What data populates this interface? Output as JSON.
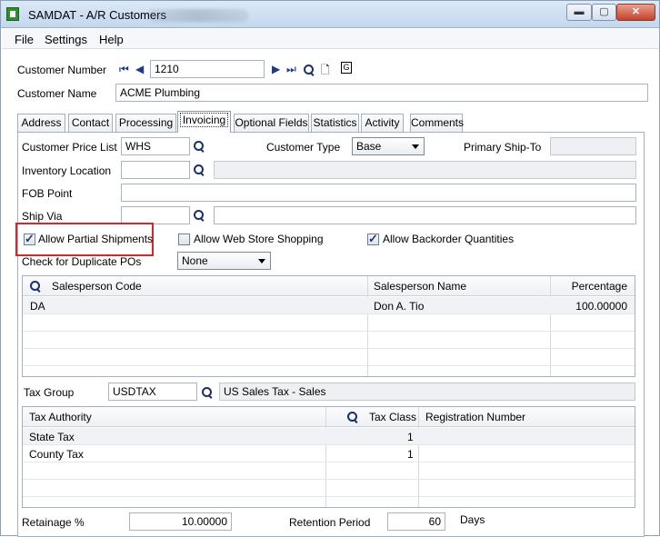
{
  "window": {
    "title": "SAMDAT - A/R Customers",
    "min_glyph": "▬",
    "max_glyph": "▢",
    "close_glyph": "✕"
  },
  "menu": {
    "items": [
      "File",
      "Settings",
      "Help"
    ]
  },
  "header": {
    "customer_number_label": "Customer Number",
    "customer_number_value": "1210",
    "customer_name_label": "Customer Name",
    "customer_name_value": "ACME Plumbing",
    "nav_icons": [
      "first-record-icon",
      "previous-record-icon",
      "next-record-icon",
      "last-record-icon",
      "lookup-icon",
      "new-document-icon",
      "copy-icon"
    ]
  },
  "tabs": [
    {
      "label": "Address"
    },
    {
      "label": "Contact"
    },
    {
      "label": "Processing"
    },
    {
      "label": "Invoicing"
    },
    {
      "label": "Optional Fields"
    },
    {
      "label": "Statistics"
    },
    {
      "label": "Activity"
    },
    {
      "label": "Comments"
    }
  ],
  "invoicing": {
    "price_list_label": "Customer Price List",
    "price_list_value": "WHS",
    "customer_type_label": "Customer Type",
    "customer_type_value": "Base",
    "primary_ship_to_label": "Primary Ship-To",
    "primary_ship_to_value": "",
    "inventory_location_label": "Inventory Location",
    "inventory_location_value": "",
    "fob_point_label": "FOB Point",
    "fob_point_value": "",
    "ship_via_label": "Ship Via",
    "ship_via_value": "",
    "allow_partial_label": "Allow Partial Shipments",
    "allow_web_label": "Allow Web Store Shopping",
    "allow_backorder_label": "Allow Backorder Quantities",
    "duplicate_po_label": "Check for Duplicate POs",
    "duplicate_po_value": "None",
    "checks": {
      "allow_partial": true,
      "allow_web": false,
      "allow_backorder": true
    }
  },
  "salesperson_table": {
    "headers": [
      "Salesperson Code",
      "Salesperson Name",
      "Percentage"
    ],
    "rows": [
      [
        "DA",
        "Don A. Tio",
        "100.00000"
      ]
    ]
  },
  "tax": {
    "group_label": "Tax Group",
    "group_value": "USDTAX",
    "group_description": "US Sales Tax - Sales",
    "headers": [
      "Tax Authority",
      "Tax Class",
      "Registration Number"
    ],
    "rows": [
      [
        "State Tax",
        "1",
        ""
      ],
      [
        "County Tax",
        "1",
        ""
      ]
    ]
  },
  "footer": {
    "retainage_label": "Retainage %",
    "retainage_value": "10.00000",
    "retention_label": "Retention Period",
    "retention_value": "60",
    "days_label": "Days"
  }
}
